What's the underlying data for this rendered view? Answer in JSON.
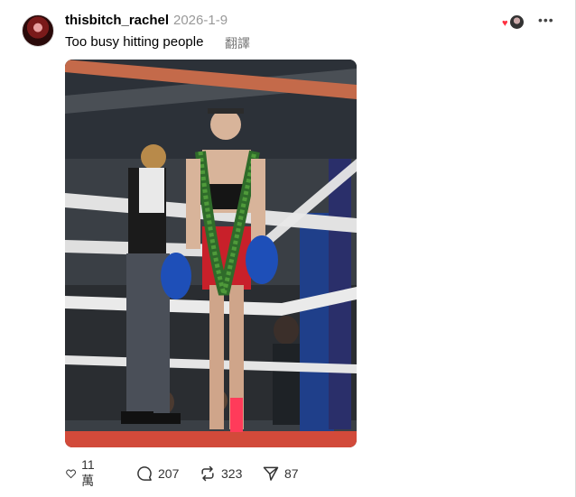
{
  "post": {
    "username": "thisbitch_rachel",
    "timestamp": "2026-1-9",
    "text": "Too busy hitting people",
    "translate_label": "翻譯"
  },
  "icons": {
    "avatar": "profile-avatar",
    "like_badge": "heart-icon",
    "more": "more-icon",
    "like": "heart-outline-icon",
    "reply": "comment-icon",
    "repost": "repost-icon",
    "share": "send-icon"
  },
  "actions": {
    "likes": "11 萬",
    "replies": "207",
    "reposts": "323",
    "shares": "87"
  },
  "colors": {
    "heart": "#ff3040",
    "muted": "#999999"
  }
}
